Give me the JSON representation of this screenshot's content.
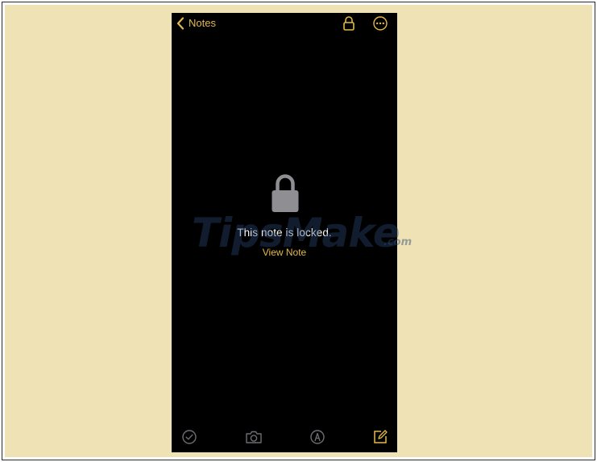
{
  "nav": {
    "back_label": "Notes"
  },
  "locked": {
    "message": "This note is locked.",
    "action_label": "View Note"
  },
  "watermark": {
    "text": "TipsMake",
    "suffix": ".com"
  },
  "icons": {
    "back": "chevron-left-icon",
    "lock": "lock-icon",
    "more": "ellipsis-circle-icon",
    "center_lock": "lock-icon",
    "checklist": "checkmark-circle-icon",
    "camera": "camera-icon",
    "markup": "pen-circle-icon",
    "compose": "compose-icon"
  },
  "colors": {
    "background": "#efe2b5",
    "screen": "#000000",
    "accent": "#e3b94a",
    "text": "#ffffff",
    "lock_gray": "#8e8e93",
    "toolbar_icon": "#6e6e73"
  }
}
